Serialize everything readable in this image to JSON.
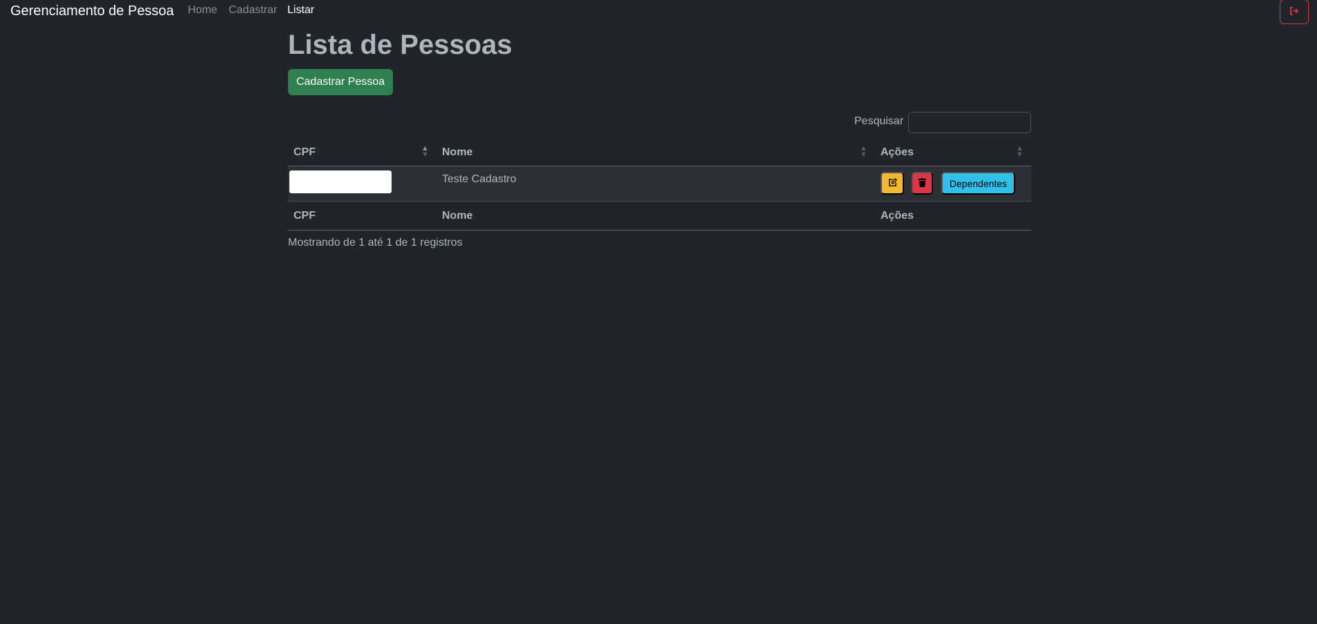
{
  "navbar": {
    "brand": "Gerenciamento de Pessoa",
    "links": [
      {
        "label": "Home",
        "active": false
      },
      {
        "label": "Cadastrar",
        "active": false
      },
      {
        "label": "Listar",
        "active": true
      }
    ],
    "logout_icon": "sign-out-icon"
  },
  "main": {
    "title": "Lista de Pessoas",
    "add_button": "Cadastrar Pessoa",
    "search_label": "Pesquisar",
    "search_value": "",
    "table": {
      "headers": [
        "CPF",
        "Nome",
        "Ações"
      ],
      "sort": {
        "column": "CPF",
        "direction": "asc"
      },
      "rows": [
        {
          "cpf": "",
          "nome": "Teste Cadastro",
          "actions": {
            "edit_icon": "edit-icon",
            "delete_icon": "trash-icon",
            "dependentes_label": "Dependentes"
          }
        }
      ],
      "footers": [
        "CPF",
        "Nome",
        "Ações"
      ]
    },
    "info": "Mostrando de 1 até 1 de 1 registros"
  },
  "colors": {
    "background": "#212529",
    "success": "#2f7f4f",
    "warning": "#f0b92f",
    "danger": "#dc3545",
    "info": "#31c0ea"
  }
}
